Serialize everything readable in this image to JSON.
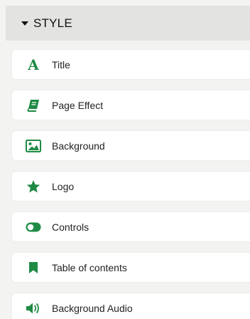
{
  "section": {
    "title": "STYLE",
    "caret_icon": "caret-down-icon"
  },
  "accent_color": "#1f8a44",
  "items": [
    {
      "label": "Title",
      "icon": "text-a-icon"
    },
    {
      "label": "Page Effect",
      "icon": "book-icon"
    },
    {
      "label": "Background",
      "icon": "image-icon"
    },
    {
      "label": "Logo",
      "icon": "star-icon"
    },
    {
      "label": "Controls",
      "icon": "toggle-icon"
    },
    {
      "label": "Table of contents",
      "icon": "bookmark-icon"
    },
    {
      "label": "Background Audio",
      "icon": "volume-icon"
    }
  ]
}
